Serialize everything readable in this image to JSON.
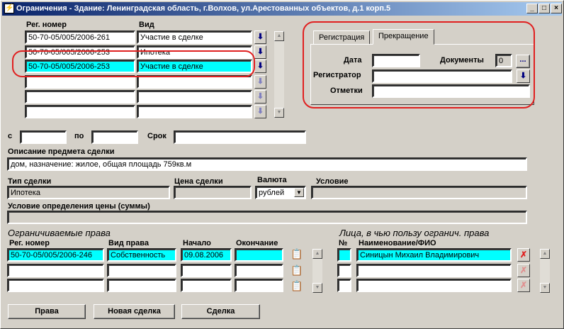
{
  "window": {
    "title": "Ограничения - Здание: Ленинградская область, г.Волхов, ул.Арестованных объектов, д.1 корп.5"
  },
  "deals": {
    "col_reg": "Рег. номер",
    "col_kind": "Вид",
    "rows": [
      {
        "reg": "50-70-05/005/2006-261",
        "kind": "Участие в сделке"
      },
      {
        "reg": "50-70-05/005/2006-253",
        "kind": "Ипотека"
      },
      {
        "reg": "50-70-05/005/2006-253",
        "kind": "Участие в сделке"
      },
      {
        "reg": "",
        "kind": ""
      },
      {
        "reg": "",
        "kind": ""
      },
      {
        "reg": "",
        "kind": ""
      }
    ]
  },
  "tabs": {
    "registration": "Регистрация",
    "termination": "Прекращение"
  },
  "termination": {
    "date_label": "Дата",
    "date_value": "",
    "docs_label": "Документы",
    "docs_count": "0",
    "docs_button": "...",
    "registrar_label": "Регистратор",
    "registrar_value": "",
    "notes_label": "Отметки",
    "notes_value": ""
  },
  "period": {
    "from_label": "с",
    "from_value": "",
    "to_label": "по",
    "to_value": "",
    "term_label": "Срок",
    "term_value": ""
  },
  "subject": {
    "label": "Описание предмета сделки",
    "value": "дом, назначение: жилое, общая площадь 759кв.м"
  },
  "deal_info": {
    "type_label": "Тип сделки",
    "type_value": "Ипотека",
    "price_label": "Цена сделки",
    "price_value": "",
    "currency_label": "Валюта",
    "currency_value": "рублей",
    "condition_label": "Условие",
    "condition_value": ""
  },
  "price_condition": {
    "label": "Условие определения цены (суммы)",
    "value": ""
  },
  "restricted_rights": {
    "heading": "Ограничиваемые права",
    "col_reg": "Рег. номер",
    "col_kind": "Вид права",
    "col_start": "Начало",
    "col_end": "Окончание",
    "rows": [
      {
        "reg": "50-70-05/005/2006-246",
        "kind": "Собственность",
        "start": "09.08.2006",
        "end": ""
      },
      {
        "reg": "",
        "kind": "",
        "start": "",
        "end": ""
      },
      {
        "reg": "",
        "kind": "",
        "start": "",
        "end": ""
      }
    ]
  },
  "beneficiaries": {
    "heading": "Лица, в чью пользу огранич. права",
    "col_num": "№",
    "col_name": "Наименование/ФИО",
    "rows": [
      {
        "num": "",
        "name": "Синицын  Михаил Владимирович"
      },
      {
        "num": "",
        "name": ""
      },
      {
        "num": "",
        "name": ""
      }
    ]
  },
  "buttons": {
    "rights": "Права",
    "new_deal": "Новая сделка",
    "deal": "Сделка"
  },
  "colors": {
    "highlight": "#00ffff",
    "annotation": "#e02020",
    "titlebar": "#0a246a"
  }
}
